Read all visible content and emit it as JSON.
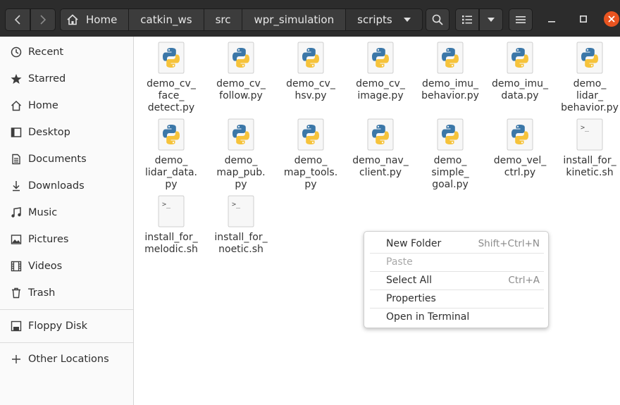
{
  "breadcrumbs": [
    "Home",
    "catkin_ws",
    "src",
    "wpr_simulation",
    "scripts"
  ],
  "sidebar": {
    "items": [
      {
        "label": "Recent",
        "icon": "clock-icon"
      },
      {
        "label": "Starred",
        "icon": "star-icon"
      },
      {
        "label": "Home",
        "icon": "home-icon"
      },
      {
        "label": "Desktop",
        "icon": "desktop-icon"
      },
      {
        "label": "Documents",
        "icon": "document-icon"
      },
      {
        "label": "Downloads",
        "icon": "download-icon"
      },
      {
        "label": "Music",
        "icon": "music-icon"
      },
      {
        "label": "Pictures",
        "icon": "picture-icon"
      },
      {
        "label": "Videos",
        "icon": "video-icon"
      },
      {
        "label": "Trash",
        "icon": "trash-icon"
      }
    ],
    "devices": [
      {
        "label": "Floppy Disk",
        "icon": "floppy-icon"
      }
    ],
    "other": [
      {
        "label": "Other Locations",
        "icon": "plus-icon"
      }
    ]
  },
  "files": [
    {
      "lines": [
        "demo_cv_",
        "face_",
        "detect.py"
      ],
      "type": "python"
    },
    {
      "lines": [
        "demo_cv_",
        "follow.py"
      ],
      "type": "python"
    },
    {
      "lines": [
        "demo_cv_",
        "hsv.py"
      ],
      "type": "python"
    },
    {
      "lines": [
        "demo_cv_",
        "image.py"
      ],
      "type": "python"
    },
    {
      "lines": [
        "demo_imu_",
        "behavior.py"
      ],
      "type": "python"
    },
    {
      "lines": [
        "demo_imu_",
        "data.py"
      ],
      "type": "python"
    },
    {
      "lines": [
        "demo_",
        "lidar_",
        "behavior.py"
      ],
      "type": "python"
    },
    {
      "lines": [
        "demo_",
        "lidar_data.",
        "py"
      ],
      "type": "python"
    },
    {
      "lines": [
        "demo_",
        "map_pub.",
        "py"
      ],
      "type": "python"
    },
    {
      "lines": [
        "demo_",
        "map_tools.",
        "py"
      ],
      "type": "python"
    },
    {
      "lines": [
        "demo_nav_",
        "client.py"
      ],
      "type": "python"
    },
    {
      "lines": [
        "demo_",
        "simple_",
        "goal.py"
      ],
      "type": "python"
    },
    {
      "lines": [
        "demo_vel_",
        "ctrl.py"
      ],
      "type": "python"
    },
    {
      "lines": [
        "install_for_",
        "kinetic.sh"
      ],
      "type": "shell"
    },
    {
      "lines": [
        "install_for_",
        "melodic.sh"
      ],
      "type": "shell"
    },
    {
      "lines": [
        "install_for_",
        "noetic.sh"
      ],
      "type": "shell"
    }
  ],
  "shell_glyph": ">_",
  "context_menu": [
    {
      "label": "New Folder",
      "accel": "Shift+Ctrl+N",
      "enabled": true
    },
    {
      "label": "Paste",
      "accel": "",
      "enabled": false
    },
    {
      "label": "Select All",
      "accel": "Ctrl+A",
      "enabled": true
    },
    {
      "label": "Properties",
      "accel": "",
      "enabled": true
    },
    {
      "label": "Open in Terminal",
      "accel": "",
      "enabled": true
    }
  ],
  "colors": {
    "headerbar": "#2c2c2c",
    "close_button": "#e95420",
    "python_blue": "#3b77a8",
    "python_yellow": "#f6c33b"
  }
}
